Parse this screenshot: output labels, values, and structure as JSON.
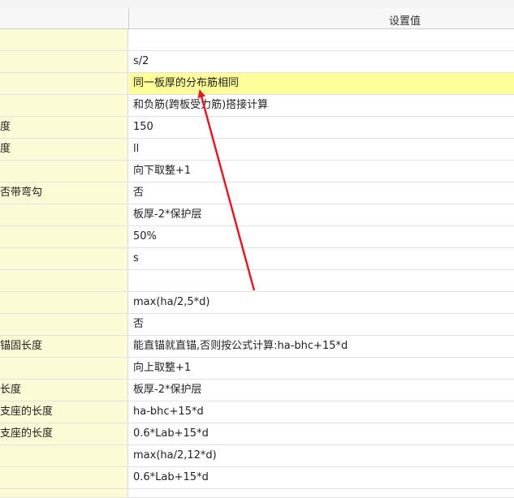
{
  "header": {
    "value_col": "设置值"
  },
  "rows": [
    {
      "label": "",
      "value": ""
    },
    {
      "label": "",
      "value": "s/2"
    },
    {
      "label": "",
      "value": "同一板厚的分布筋相同"
    },
    {
      "label": "",
      "value": "和负筋(跨板受力筋)搭接计算"
    },
    {
      "label": "度",
      "value": "150"
    },
    {
      "label": "度",
      "value": "ll"
    },
    {
      "label": "",
      "value": "向下取整+1"
    },
    {
      "label": "否带弯勾",
      "value": "否"
    },
    {
      "label": "",
      "value": "板厚-2*保护层"
    },
    {
      "label": "",
      "value": "50%"
    },
    {
      "label": "",
      "value": "s"
    },
    {
      "label": "",
      "value": ""
    },
    {
      "label": "",
      "value": "max(ha/2,5*d)"
    },
    {
      "label": "",
      "value": "否"
    },
    {
      "label": "锚固长度",
      "value": "能直锚就直锚,否则按公式计算:ha-bhc+15*d"
    },
    {
      "label": "",
      "value": "向上取整+1"
    },
    {
      "label": "长度",
      "value": "板厚-2*保护层"
    },
    {
      "label": "支座的长度",
      "value": "ha-bhc+15*d"
    },
    {
      "label": "支座的长度",
      "value": "0.6*Lab+15*d"
    },
    {
      "label": "",
      "value": "max(ha/2,12*d)"
    },
    {
      "label": "",
      "value": "0.6*Lab+15*d"
    },
    {
      "label": "",
      "value": ""
    }
  ],
  "colors": {
    "label_bg": "#fbfbd6",
    "highlight_bg": "#ffff99",
    "arrow": "#e01b24"
  }
}
